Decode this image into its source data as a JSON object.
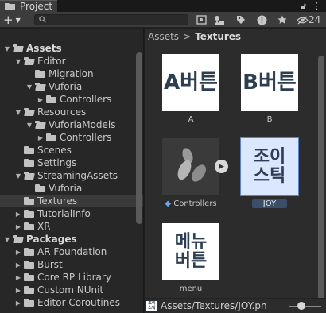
{
  "tab": {
    "label": "Project",
    "lock_icon": "lock-icon",
    "menu_icon": "kebab-menu-icon"
  },
  "toolbar": {
    "add_label": "+",
    "search": {
      "placeholder": "",
      "value": ""
    },
    "hidden_count": "24"
  },
  "tree": {
    "rows": [
      {
        "label": "Assets",
        "indent": 0,
        "arrow": "▼",
        "bold": true,
        "open": true
      },
      {
        "label": "Editor",
        "indent": 1,
        "arrow": "▼",
        "open": true
      },
      {
        "label": "Migration",
        "indent": 2,
        "arrow": ""
      },
      {
        "label": "Vuforia",
        "indent": 2,
        "arrow": "▼",
        "open": true
      },
      {
        "label": "Controllers",
        "indent": 3,
        "arrow": "▶"
      },
      {
        "label": "Resources",
        "indent": 1,
        "arrow": "▼",
        "open": true
      },
      {
        "label": "VuforiaModels",
        "indent": 2,
        "arrow": "▼",
        "open": true
      },
      {
        "label": "Controllers",
        "indent": 3,
        "arrow": "▶"
      },
      {
        "label": "Scenes",
        "indent": 1,
        "arrow": ""
      },
      {
        "label": "Settings",
        "indent": 1,
        "arrow": ""
      },
      {
        "label": "StreamingAssets",
        "indent": 1,
        "arrow": "▼",
        "open": true
      },
      {
        "label": "Vuforia",
        "indent": 2,
        "arrow": ""
      },
      {
        "label": "Textures",
        "indent": 1,
        "arrow": "",
        "selected": true
      },
      {
        "label": "TutorialInfo",
        "indent": 1,
        "arrow": "▶"
      },
      {
        "label": "XR",
        "indent": 1,
        "arrow": "▶"
      },
      {
        "label": "Packages",
        "indent": 0,
        "arrow": "▼",
        "bold": true,
        "open": true
      },
      {
        "label": "AR Foundation",
        "indent": 1,
        "arrow": "▶"
      },
      {
        "label": "Burst",
        "indent": 1,
        "arrow": "▶"
      },
      {
        "label": "Core RP Library",
        "indent": 1,
        "arrow": "▶"
      },
      {
        "label": "Custom NUnit",
        "indent": 1,
        "arrow": "▶"
      },
      {
        "label": "Editor Coroutines",
        "indent": 1,
        "arrow": "▶"
      }
    ]
  },
  "breadcrumb": {
    "root": "Assets",
    "separator": ">",
    "current": "Textures"
  },
  "assets": [
    {
      "thumb_lines": [
        "A버튼"
      ],
      "label": "A",
      "kind": "texture"
    },
    {
      "thumb_lines": [
        "B버튼"
      ],
      "label": "B",
      "kind": "texture"
    },
    {
      "thumb_lines": [],
      "label": "Controllers",
      "kind": "model",
      "play": "▶"
    },
    {
      "thumb_lines": [
        "조이",
        "스틱"
      ],
      "label": "JOY",
      "kind": "texture",
      "selected": true
    },
    {
      "thumb_lines": [
        "메뉴",
        "버튼"
      ],
      "label": "menu",
      "kind": "texture"
    }
  ],
  "status": {
    "path": "Assets/Textures/JOY.png",
    "thumb_text": "조이\n스틱"
  },
  "colors": {
    "selected_thumb": "#dbe6ff",
    "accent": "#5c82c8"
  }
}
